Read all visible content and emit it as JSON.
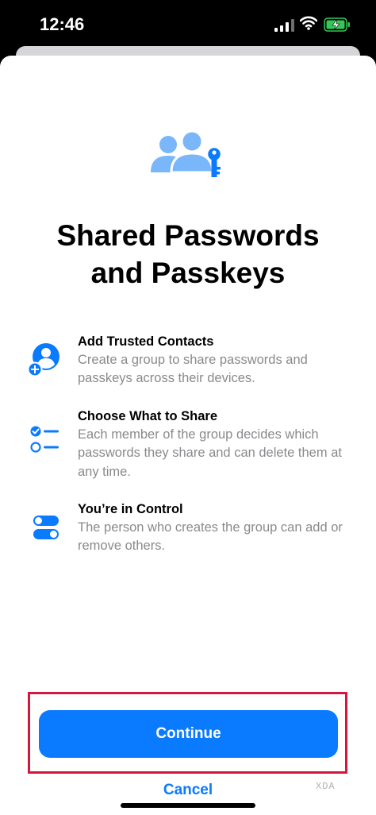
{
  "status_bar": {
    "time": "12:46"
  },
  "hero": {
    "icon": "people-key-icon"
  },
  "title": {
    "line1": "Shared Passwords",
    "line2": "and Passkeys"
  },
  "features": [
    {
      "icon": "person-add-icon",
      "title": "Add Trusted Contacts",
      "description": "Create a group to share passwords and passkeys across their devices."
    },
    {
      "icon": "checklist-icon",
      "title": "Choose What to Share",
      "description": "Each member of the group decides which passwords they share and can delete them at any time."
    },
    {
      "icon": "toggles-icon",
      "title": "You’re in Control",
      "description": "The person who creates the group can add or remove others."
    }
  ],
  "buttons": {
    "continue": "Continue",
    "cancel": "Cancel"
  },
  "watermark": "XDA",
  "colors": {
    "accent": "#0a7afe",
    "accent_light": "#79b7fa",
    "highlight": "#d5163d",
    "secondary_text": "#8a8a8e"
  }
}
